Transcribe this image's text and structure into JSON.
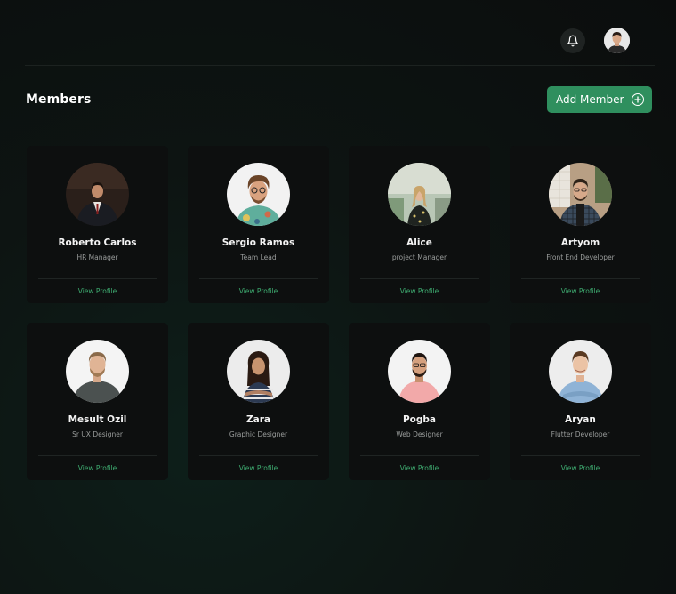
{
  "header": {
    "notification_icon": "bell-icon",
    "user_avatar": "user-avatar"
  },
  "page": {
    "title": "Members",
    "add_button_label": "Add Member",
    "add_button_icon": "plus-circle-icon"
  },
  "colors": {
    "accent": "#2f8f5e",
    "link": "#3fae72",
    "card_bg": "#0d0f0f"
  },
  "members": [
    {
      "name": "Roberto Carlos",
      "role": "HR Manager",
      "link": "View Profile"
    },
    {
      "name": "Sergio Ramos",
      "role": "Team Lead",
      "link": "View Profile"
    },
    {
      "name": "Alice",
      "role": "project Manager",
      "link": "View Profile"
    },
    {
      "name": "Artyom",
      "role": "Front End Developer",
      "link": "View Profile"
    },
    {
      "name": "Mesult Ozil",
      "role": "Sr UX Designer",
      "link": "View Profile"
    },
    {
      "name": "Zara",
      "role": "Graphic Designer",
      "link": "View Profile"
    },
    {
      "name": "Pogba",
      "role": "Web Designer",
      "link": "View Profile"
    },
    {
      "name": "Aryan",
      "role": "Flutter Developer",
      "link": "View Profile"
    }
  ]
}
